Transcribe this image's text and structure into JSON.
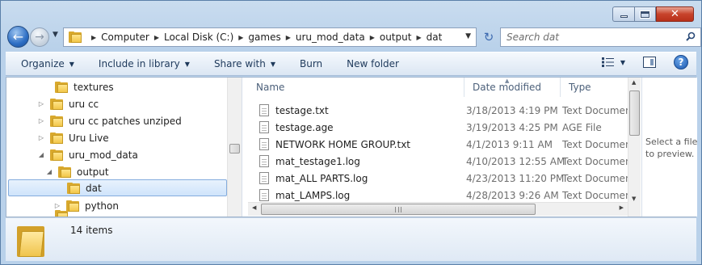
{
  "window": {
    "caption_close": "✕"
  },
  "nav": {
    "breadcrumbs": [
      "Computer",
      "Local Disk (C:)",
      "games",
      "uru_mod_data",
      "output",
      "dat"
    ],
    "search_placeholder": "Search dat"
  },
  "toolbar": {
    "organize": "Organize",
    "include_in_library": "Include in library",
    "share_with": "Share with",
    "burn": "Burn",
    "new_folder": "New folder",
    "help": "?"
  },
  "tree": {
    "items": [
      {
        "label": "textures",
        "expander": ""
      },
      {
        "label": "uru cc",
        "expander": "▷"
      },
      {
        "label": "uru cc patches unziped",
        "expander": "▷"
      },
      {
        "label": "Uru Live",
        "expander": "▷"
      },
      {
        "label": "uru_mod_data",
        "expander": "◢"
      },
      {
        "label": "output",
        "expander": "◢"
      },
      {
        "label": "dat",
        "expander": ""
      },
      {
        "label": "python",
        "expander": "▷"
      }
    ]
  },
  "file_list": {
    "columns": [
      "Name",
      "Date modified",
      "Type"
    ],
    "rows": [
      {
        "name": "testage.txt",
        "date": "3/18/2013 4:19 PM",
        "type": "Text Document"
      },
      {
        "name": "testage.age",
        "date": "3/19/2013 4:25 PM",
        "type": "AGE File"
      },
      {
        "name": "NETWORK HOME GROUP.txt",
        "date": "4/1/2013 9:11 AM",
        "type": "Text Document"
      },
      {
        "name": "mat_testage1.log",
        "date": "4/10/2013 12:55 AM",
        "type": "Text Document"
      },
      {
        "name": "mat_ALL PARTS.log",
        "date": "4/23/2013 11:20 PM",
        "type": "Text Document"
      },
      {
        "name": "mat_LAMPS.log",
        "date": "4/28/2013 9:26 AM",
        "type": "Text Document"
      }
    ]
  },
  "preview": {
    "message": "Select a file to preview."
  },
  "details": {
    "item_count": "14 items"
  },
  "colors": {
    "accent": "#1e395b",
    "selection": "#cfe4fb",
    "frame": "#b9d1ea"
  }
}
